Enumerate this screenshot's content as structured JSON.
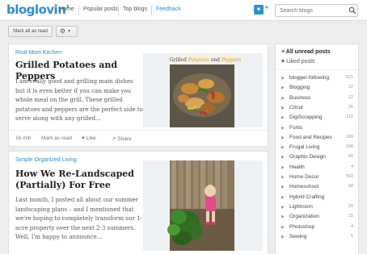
{
  "header": {
    "logo": "bloglovin'",
    "nav": [
      "Home",
      "Popular posts",
      "Top blogs",
      "Feedback"
    ],
    "search_placeholder": "Search blogs"
  },
  "toolbar": {
    "mark_all_label": "Mark all as read",
    "gear_icon": "gear-icon"
  },
  "posts": [
    {
      "source": "Real Mom Kitchen",
      "title": "Grilled Potatoes and Peppers",
      "excerpt": "I am really good and grilling main dishes but it is even better if you can make you whole meal on the grill. These grilled potatoes and peppers are the perfect side to serve along with any grilled…",
      "thumb_caption_1": "Grilled ",
      "thumb_caption_2": "Potatoes",
      "thumb_caption_3": " and ",
      "thumb_caption_4": "Peppers",
      "time": "16 min",
      "mark_as_read": "Mark as read",
      "like": "Like",
      "share": "Share"
    },
    {
      "source": "Simple Organized Living",
      "title": "How We Re-Landscaped (Partially) For Free",
      "excerpt": "Last month, I posted all about our summer landscaping plans – and I mentioned that we're hoping to completely transform our 1-acre property over the next 2-3 summers. Well, I'm happy to announce…"
    }
  ],
  "sidebar": {
    "all_unread": "All unread posts",
    "liked": "Liked posts",
    "categories": [
      {
        "name": "blogger-following",
        "count": "621"
      },
      {
        "name": "Blogging",
        "count": "12"
      },
      {
        "name": "Business",
        "count": "12"
      },
      {
        "name": "Cricut",
        "count": "26"
      },
      {
        "name": "DigiScrapping",
        "count": "116"
      },
      {
        "name": "Fonts",
        "count": ""
      },
      {
        "name": "Food and Recipes",
        "count": "199"
      },
      {
        "name": "Frugal Living",
        "count": "348"
      },
      {
        "name": "Graphic Design",
        "count": "68"
      },
      {
        "name": "Health",
        "count": "4"
      },
      {
        "name": "Home Decor",
        "count": "592"
      },
      {
        "name": "Homeschool",
        "count": "58"
      },
      {
        "name": "Hybrid Crafting",
        "count": ""
      },
      {
        "name": "Lightroom",
        "count": "20"
      },
      {
        "name": "Organization",
        "count": "15"
      },
      {
        "name": "Photoshop",
        "count": "4"
      },
      {
        "name": "Sewing",
        "count": "5"
      }
    ]
  },
  "colors": {
    "accent": "#2b8fd8",
    "background": "#ecedef"
  }
}
